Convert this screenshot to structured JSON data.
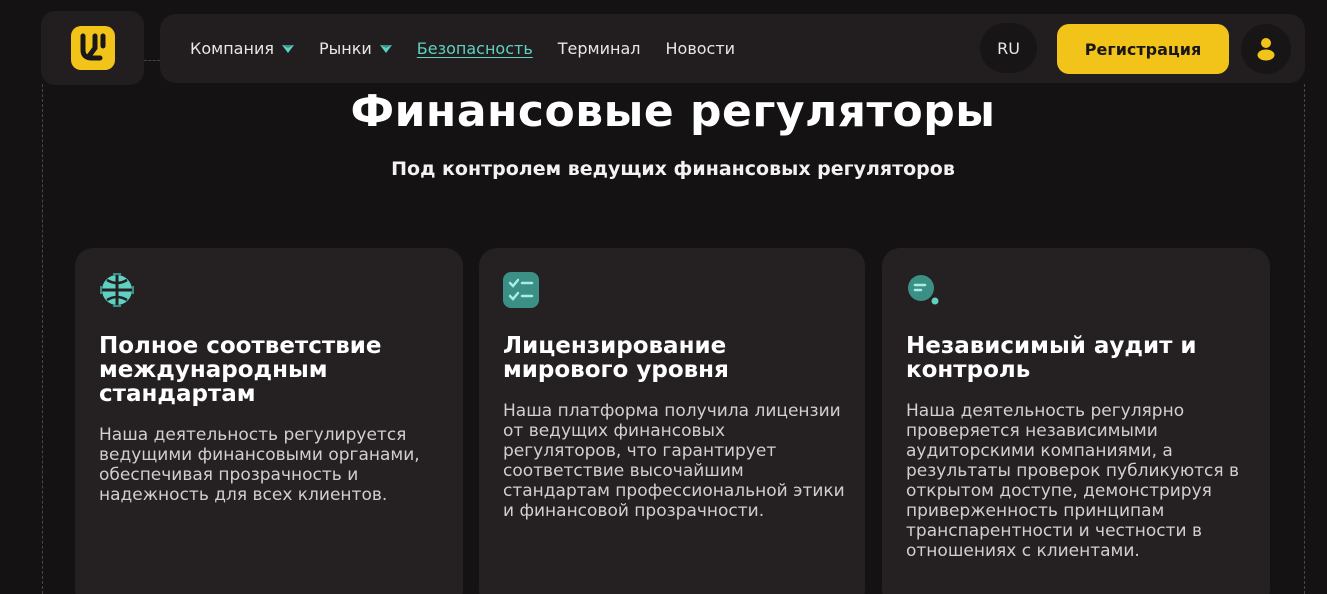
{
  "header": {
    "nav": [
      {
        "label": "Компания"
      },
      {
        "label": "Рынки"
      },
      {
        "label": "Безопасность"
      },
      {
        "label": "Терминал"
      },
      {
        "label": "Новости"
      }
    ],
    "lang": "RU",
    "register_label": "Регистрация"
  },
  "main": {
    "title": "Финансовые регуляторы",
    "subtitle": "Под контролем ведущих финансовых регуляторов",
    "cards": [
      {
        "icon": "globe-icon",
        "title": "Полное соответствие международным стандартам",
        "text": "Наша деятельность регулируется ведущими финансовыми органами, обеспечивая прозрачность и надежность для всех клиентов."
      },
      {
        "icon": "checklist-icon",
        "title": "Лицензирование мирового уровня",
        "text": "Наша платформа получила лицензии от ведущих финансовых регуляторов, что гарантирует соответствие высочайшим стандартам профессиональной этики и финансовой прозрачности."
      },
      {
        "icon": "chat-icon",
        "title": "Независимый аудит и контроль",
        "text": "Наша деятельность регулярно проверяется независимыми аудиторскими компаниями, а результаты проверок публикуются в открытом доступе, демонстрируя приверженность принципам транспарентности и честности в отношениях с клиентами."
      }
    ]
  },
  "colors": {
    "background": "#151214",
    "accent": "#f2c319",
    "teal": "#5fd1c1",
    "card": "#252022"
  }
}
